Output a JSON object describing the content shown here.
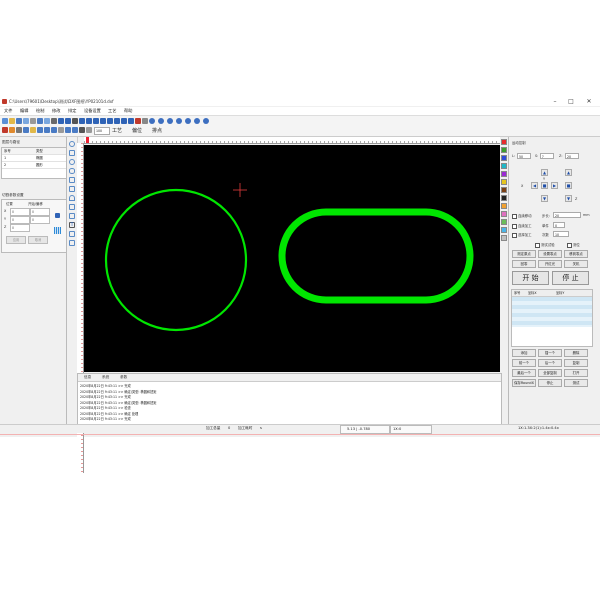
{
  "window": {
    "title": "C:\\Users\\79601\\Desktop\\测试\\DXF图纸\\YP02101d.dxf",
    "minimize": "–",
    "maximize": "□",
    "close": "✕"
  },
  "menu": [
    "文件",
    "编辑",
    "绘制",
    "修改",
    "排定",
    "设备设置",
    "工艺",
    "帮助"
  ],
  "toolbar": {
    "zoom_field": "100",
    "process_label": "工艺",
    "offset_label": "偏位",
    "point_label": "排点"
  },
  "left_panel": {
    "layers_title": "图层与路径",
    "columns": [
      "序号",
      "类型"
    ],
    "rows": [
      {
        "index": "1",
        "type": "椭圆"
      },
      {
        "index": "2",
        "type": "圆形"
      }
    ],
    "params_title": "切割参数设置",
    "field_labels": [
      "X",
      "Y",
      "Z"
    ],
    "field_values": [
      "0",
      "0",
      "0"
    ],
    "header_labels": [
      "位置",
      "开始/偏移"
    ],
    "button_apply": "应用",
    "button_cancel": "取消"
  },
  "messages": {
    "tabs": [
      "信息",
      "系统",
      "参数"
    ],
    "lines": [
      "2020年8月22日 9:43:11 >> 完成",
      "2020年8月22日 9:43:11 >> 确定(类型: 椭圆和扭矩",
      "2020年8月22日 9:43:11 >> 完成",
      "2020年8月22日 9:43:11 >> 确定(类型: 椭圆和扭矩",
      "2020年8月22日 9:43:11 >> 检查",
      "2020年8月22日 9:43:11 >> 确定 处理",
      "2020年8月22日 9:43:11 >> 完成"
    ]
  },
  "right_panel": {
    "title": "运动控制",
    "selects": [
      {
        "label": "L:",
        "value": "50"
      },
      {
        "label": "S:",
        "value": "?"
      },
      {
        "label": "Z:",
        "value": "20"
      }
    ],
    "axis_labels": [
      "X",
      "Y",
      "Z"
    ],
    "link_label": "连续移动",
    "step_label": "步长:",
    "step_value": "20",
    "step_unit": "mm",
    "options": [
      "连续加工",
      "选择加工"
    ],
    "speed_label": "单件",
    "count_label": "次数",
    "count_value": "10",
    "counter": "0",
    "check_test": "测试试验",
    "check_cam": "测位",
    "btn_row1": [
      "测定原点",
      "设置零点",
      "移到零点"
    ],
    "btn_row2": [
      "回零",
      "开红光",
      "关机"
    ],
    "start": "开 始",
    "stop": "停 止",
    "table_columns": [
      "序号",
      "坐标X",
      "坐标Y"
    ],
    "btn_row3": [
      "添加",
      "插一个",
      "删除"
    ],
    "btn_row4": [
      "前一个",
      "后一个",
      "复制"
    ],
    "btn_row5": [
      "最后一个",
      "全部复制",
      "打开"
    ],
    "btn_row6": [
      "保存RoundX",
      "停止",
      "测试"
    ]
  },
  "status": {
    "time_label": "加工总量",
    "time_value": "0",
    "parts_label": "加工耗时",
    "parts_value": "s",
    "coords": "5.13 | -0.780",
    "zoom": "1X:0",
    "extra": "1X:1.3X:2(1):1.4x:0.4x"
  },
  "colors": {
    "palette": [
      "#e8282b",
      "#3b9d2c",
      "#2f4bd8",
      "#21b7c7",
      "#9b2ad4",
      "#e6c61e",
      "#7a3f14",
      "#222222",
      "#f0a030",
      "#e070c0",
      "#6bbd5a",
      "#4ab6e8",
      "#c0c0c0"
    ],
    "shape_stroke": "#00e600",
    "canvas": "#000000"
  }
}
